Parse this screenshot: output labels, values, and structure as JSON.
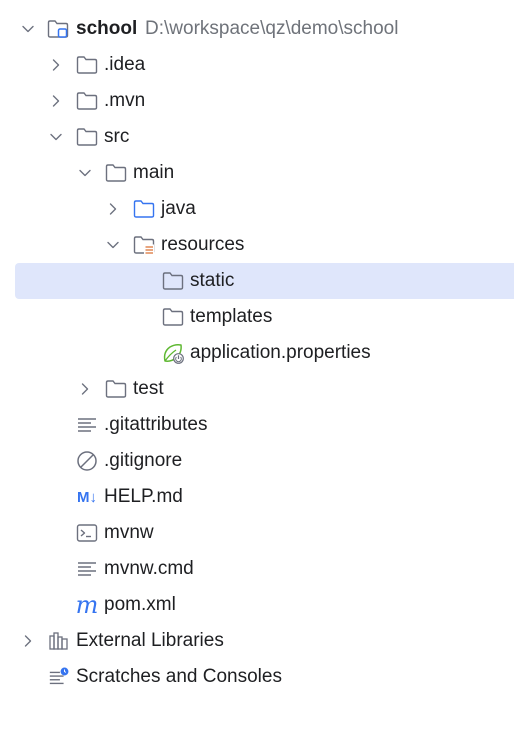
{
  "project": {
    "name": "school",
    "path": "D:\\workspace\\qz\\demo\\school"
  },
  "items": {
    "idea": ".idea",
    "mvn": ".mvn",
    "src": "src",
    "main": "main",
    "java": "java",
    "resources": "resources",
    "static": "static",
    "templates": "templates",
    "app_props": "application.properties",
    "test": "test",
    "gitattributes": ".gitattributes",
    "gitignore": ".gitignore",
    "help": "HELP.md",
    "help_badge": "M↓",
    "mvnw": "mvnw",
    "mvnw_cmd": "mvnw.cmd",
    "pom": "pom.xml",
    "pom_badge": "m",
    "external_libraries": "External Libraries",
    "scratches": "Scratches and Consoles"
  },
  "icons": {
    "chevron_down": "chevron-down-icon",
    "chevron_right": "chevron-right-icon",
    "folder": "folder-icon",
    "module_folder": "module-folder-icon",
    "source_folder": "source-folder-icon",
    "resources_folder": "resources-folder-icon",
    "spring_properties": "spring-properties-icon",
    "text_file": "text-file-icon",
    "ignore_file": "ignore-file-icon",
    "markdown_file": "markdown-file-icon",
    "shell_file": "shell-script-icon",
    "maven_file": "maven-icon",
    "libraries": "libraries-icon",
    "scratches": "scratches-icon"
  },
  "colors": {
    "selection": "#dfe6fb",
    "folder_stroke": "#6c707e",
    "source_folder": "#3574f0",
    "spring_green": "#5fb832",
    "resources_orange": "#e08855",
    "path_gray": "#6f737a"
  }
}
